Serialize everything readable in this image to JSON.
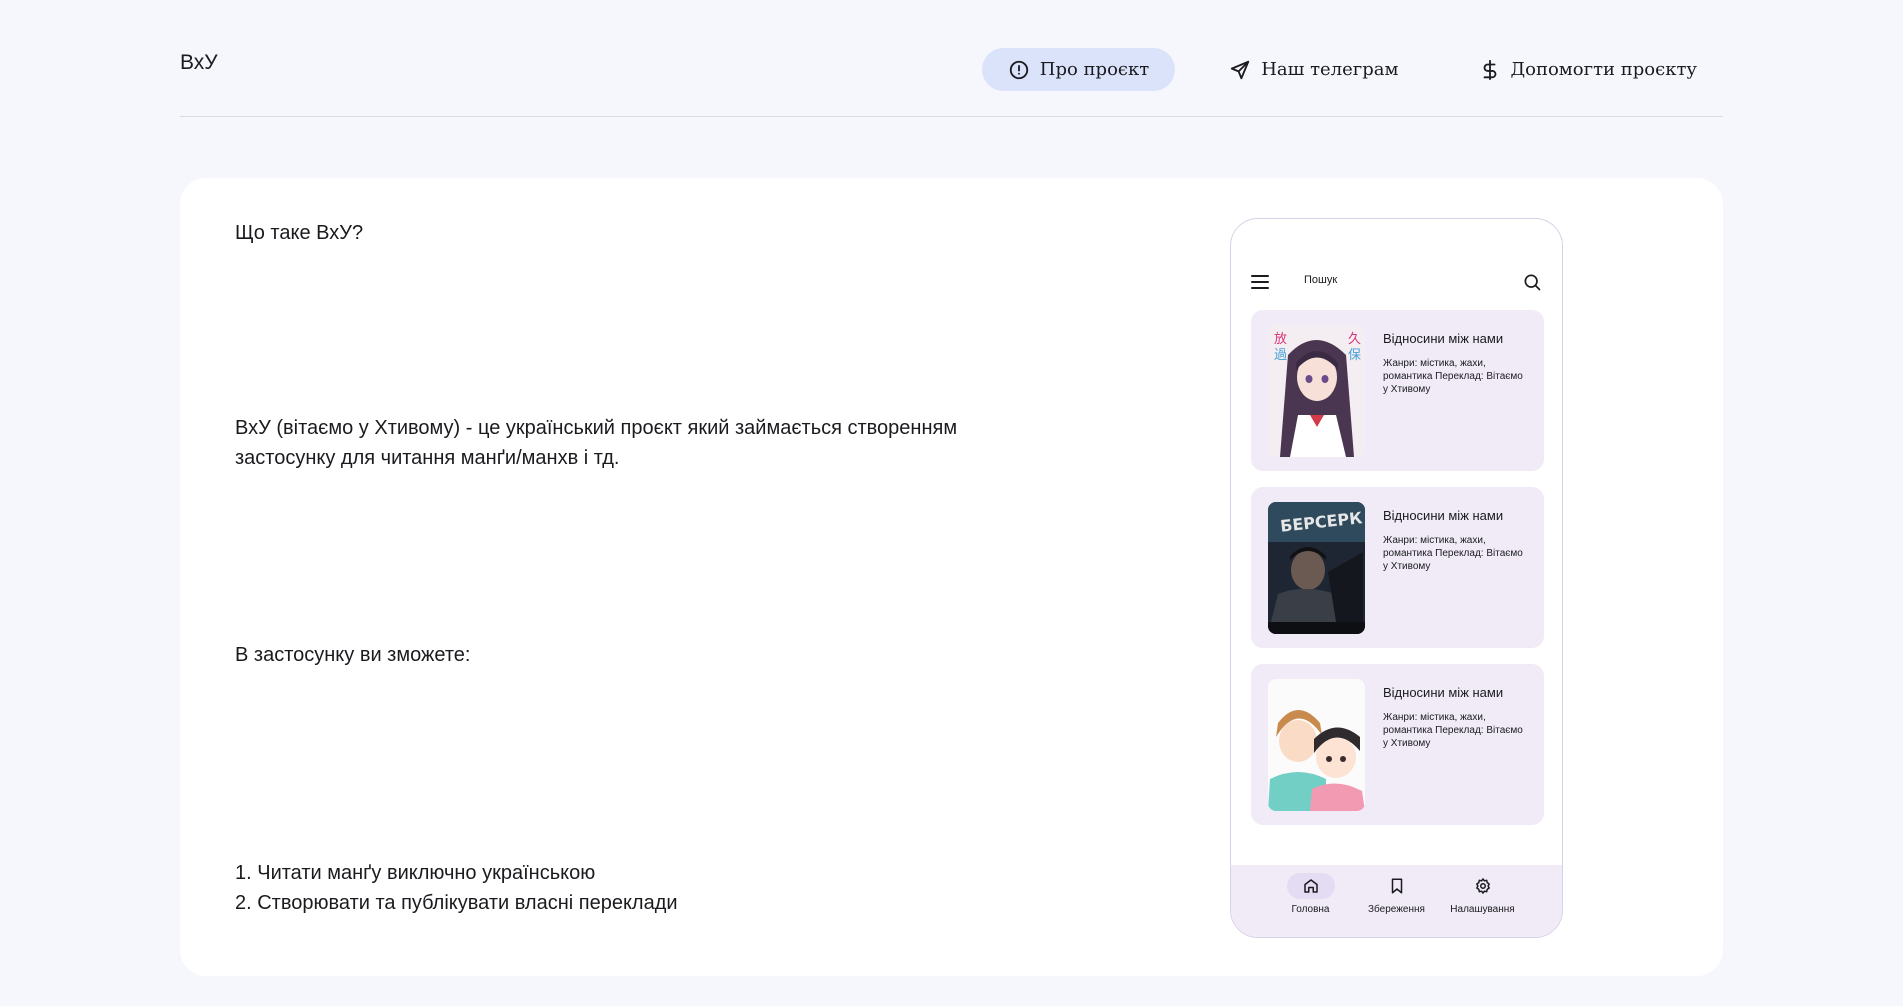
{
  "header": {
    "brand": "ВхУ",
    "nav": [
      {
        "label": "Про  проєкт",
        "icon": "info-circle-icon",
        "active": true
      },
      {
        "label": "Наш  телеграм",
        "icon": "send-icon",
        "active": false
      },
      {
        "label": "Допомогти  проєкту",
        "icon": "dollar-icon",
        "active": false
      }
    ]
  },
  "content": {
    "question": "Що таке ВхУ?",
    "description": "ВхУ (вітаємо у Хтивому) - це український проєкт який займається створенням застосунку для читання манґи/манхв і тд.",
    "can_heading": "В застосунку ви зможете:",
    "features": [
      "1. Читати манґу виключно українською",
      "2. Створювати та публікувати власні переклади"
    ]
  },
  "phone": {
    "search_label": "Пошук",
    "items": [
      {
        "title": "Відносини між нами",
        "meta": "Жанри: містика, жахи, романтика\nПереклад: Вітаємо у Хтивому",
        "cover": "anime-girl-cover"
      },
      {
        "title": "Відносини між нами",
        "meta": "Жанри: містика, жахи, романтика\nПереклад: Вітаємо у Хтивому",
        "cover": "berserk-cover"
      },
      {
        "title": "Відносини між нами",
        "meta": "Жанри: містика, жахи, романтика\nПереклад: Вітаємо у Хтивому",
        "cover": "two-characters-cover"
      }
    ],
    "tabs": [
      {
        "label": "Головна",
        "icon": "home-icon",
        "active": true
      },
      {
        "label": "Збереження",
        "icon": "bookmark-icon",
        "active": false
      },
      {
        "label": "Налашування",
        "icon": "gear-icon",
        "active": false
      }
    ]
  },
  "colors": {
    "page_bg": "#f6f7fd",
    "card_bg": "#ffffff",
    "active_nav_bg": "#dbe3fb",
    "phone_card_bg": "#f0ebf7"
  }
}
